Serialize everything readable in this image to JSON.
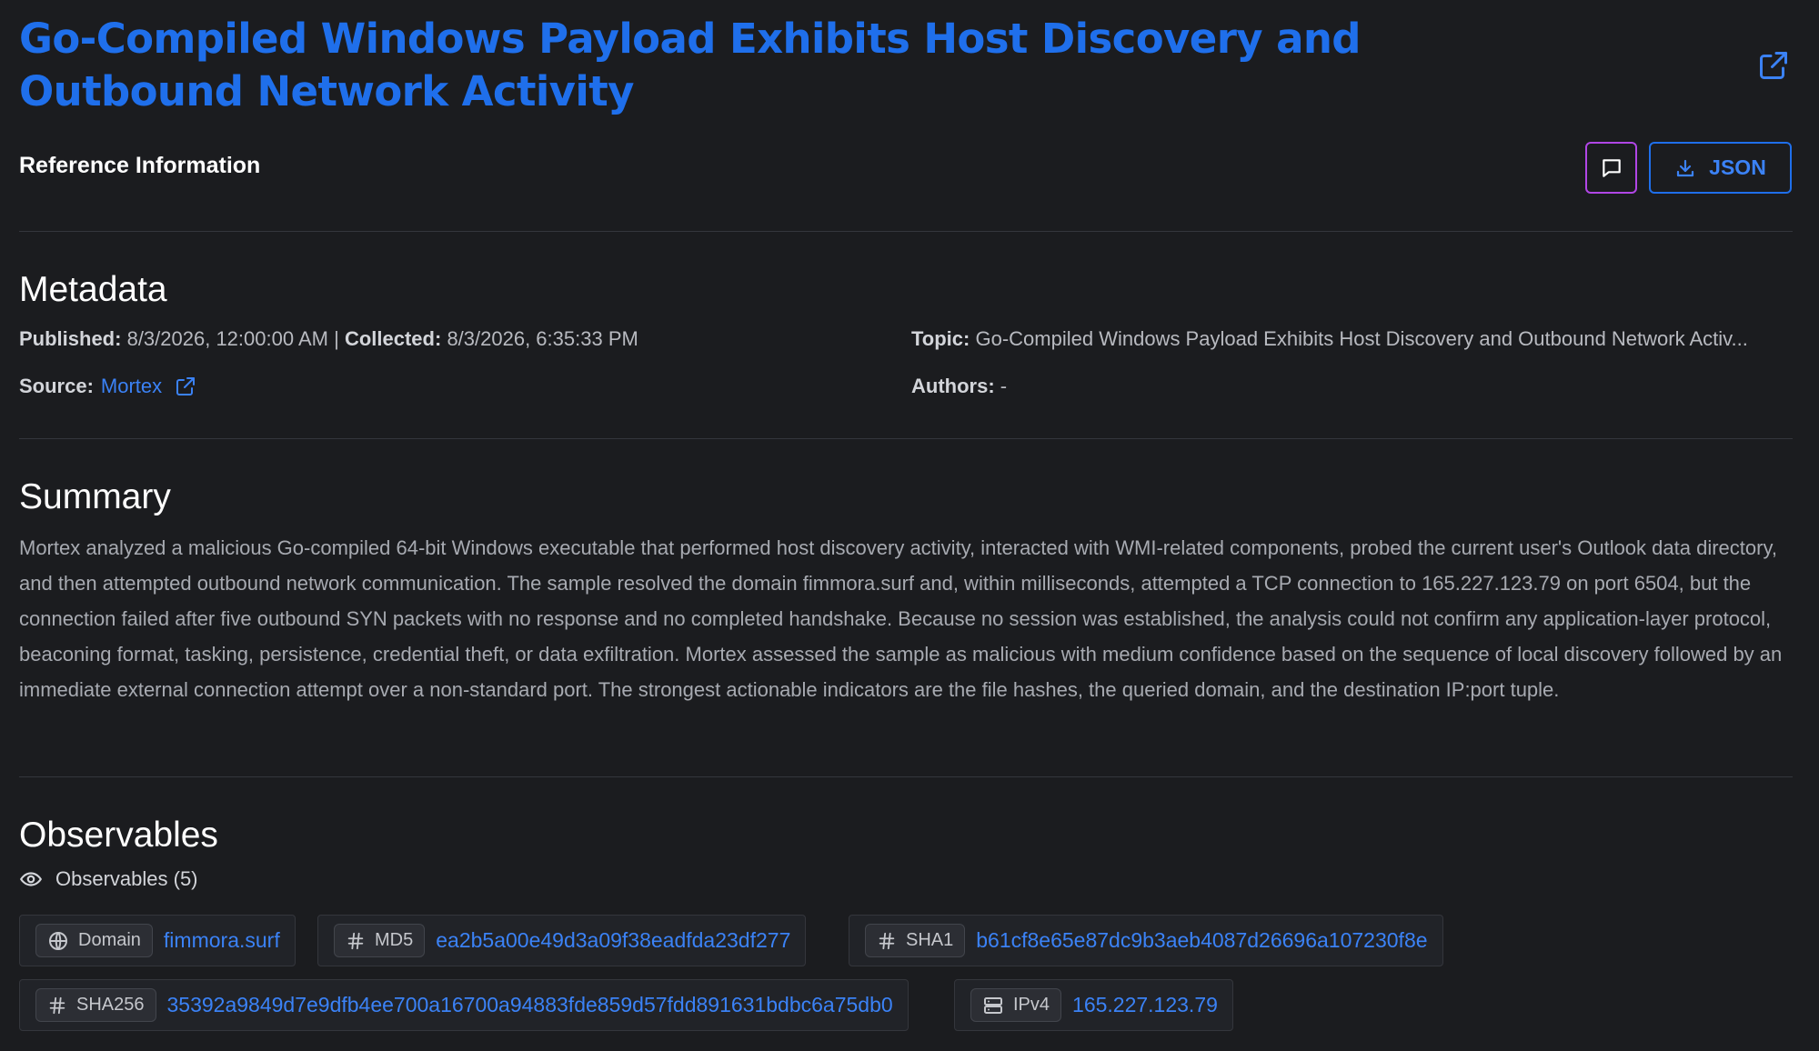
{
  "header": {
    "title": "Go-Compiled Windows Payload Exhibits Host Discovery and Outbound Network Activity",
    "reference_label": "Reference Information",
    "json_button_label": "JSON"
  },
  "metadata": {
    "heading": "Metadata",
    "published_label": "Published:",
    "published_value": "8/3/2026, 12:00:00 AM",
    "separator": "|",
    "collected_label": "Collected:",
    "collected_value": "8/3/2026, 6:35:33 PM",
    "topic_label": "Topic:",
    "topic_value": "Go-Compiled Windows Payload Exhibits Host Discovery and Outbound Network Activ...",
    "source_label": "Source:",
    "source_value": "Mortex",
    "authors_label": "Authors:",
    "authors_value": "-"
  },
  "summary": {
    "heading": "Summary",
    "text": "Mortex analyzed a malicious Go-compiled 64-bit Windows executable that performed host discovery activity, interacted with WMI-related components, probed the current user's Outlook data directory, and then attempted outbound network communication. The sample resolved the domain fimmora.surf and, within milliseconds, attempted a TCP connection to 165.227.123.79 on port 6504, but the connection failed after five outbound SYN packets with no response and no completed handshake. Because no session was established, the analysis could not confirm any application-layer protocol, beaconing format, tasking, persistence, credential theft, or data exfiltration. Mortex assessed the sample as malicious with medium confidence based on the sequence of local discovery followed by an immediate external connection attempt over a non-standard port. The strongest actionable indicators are the file hashes, the queried domain, and the destination IP:port tuple."
  },
  "observables": {
    "heading": "Observables",
    "count_label": "Observables (5)",
    "items": [
      {
        "type": "Domain",
        "icon": "globe-icon",
        "value": "fimmora.surf"
      },
      {
        "type": "MD5",
        "icon": "hash-icon",
        "value": "ea2b5a00e49d3a09f38eadfda23df277"
      },
      {
        "type": "SHA1",
        "icon": "hash-icon",
        "value": "b61cf8e65e87dc9b3aeb4087d26696a107230f8e"
      },
      {
        "type": "SHA256",
        "icon": "hash-icon",
        "value": "35392a9849d7e9dfb4ee700a16700a94883fde859d57fdd891631bdbc6a75db0"
      },
      {
        "type": "IPv4",
        "icon": "server-icon",
        "value": "165.227.123.79"
      }
    ]
  },
  "colors": {
    "background": "#1b1c1f",
    "accent": "#1f6feb",
    "link": "#3b82f6",
    "chat_button_border": "#b146e6"
  }
}
